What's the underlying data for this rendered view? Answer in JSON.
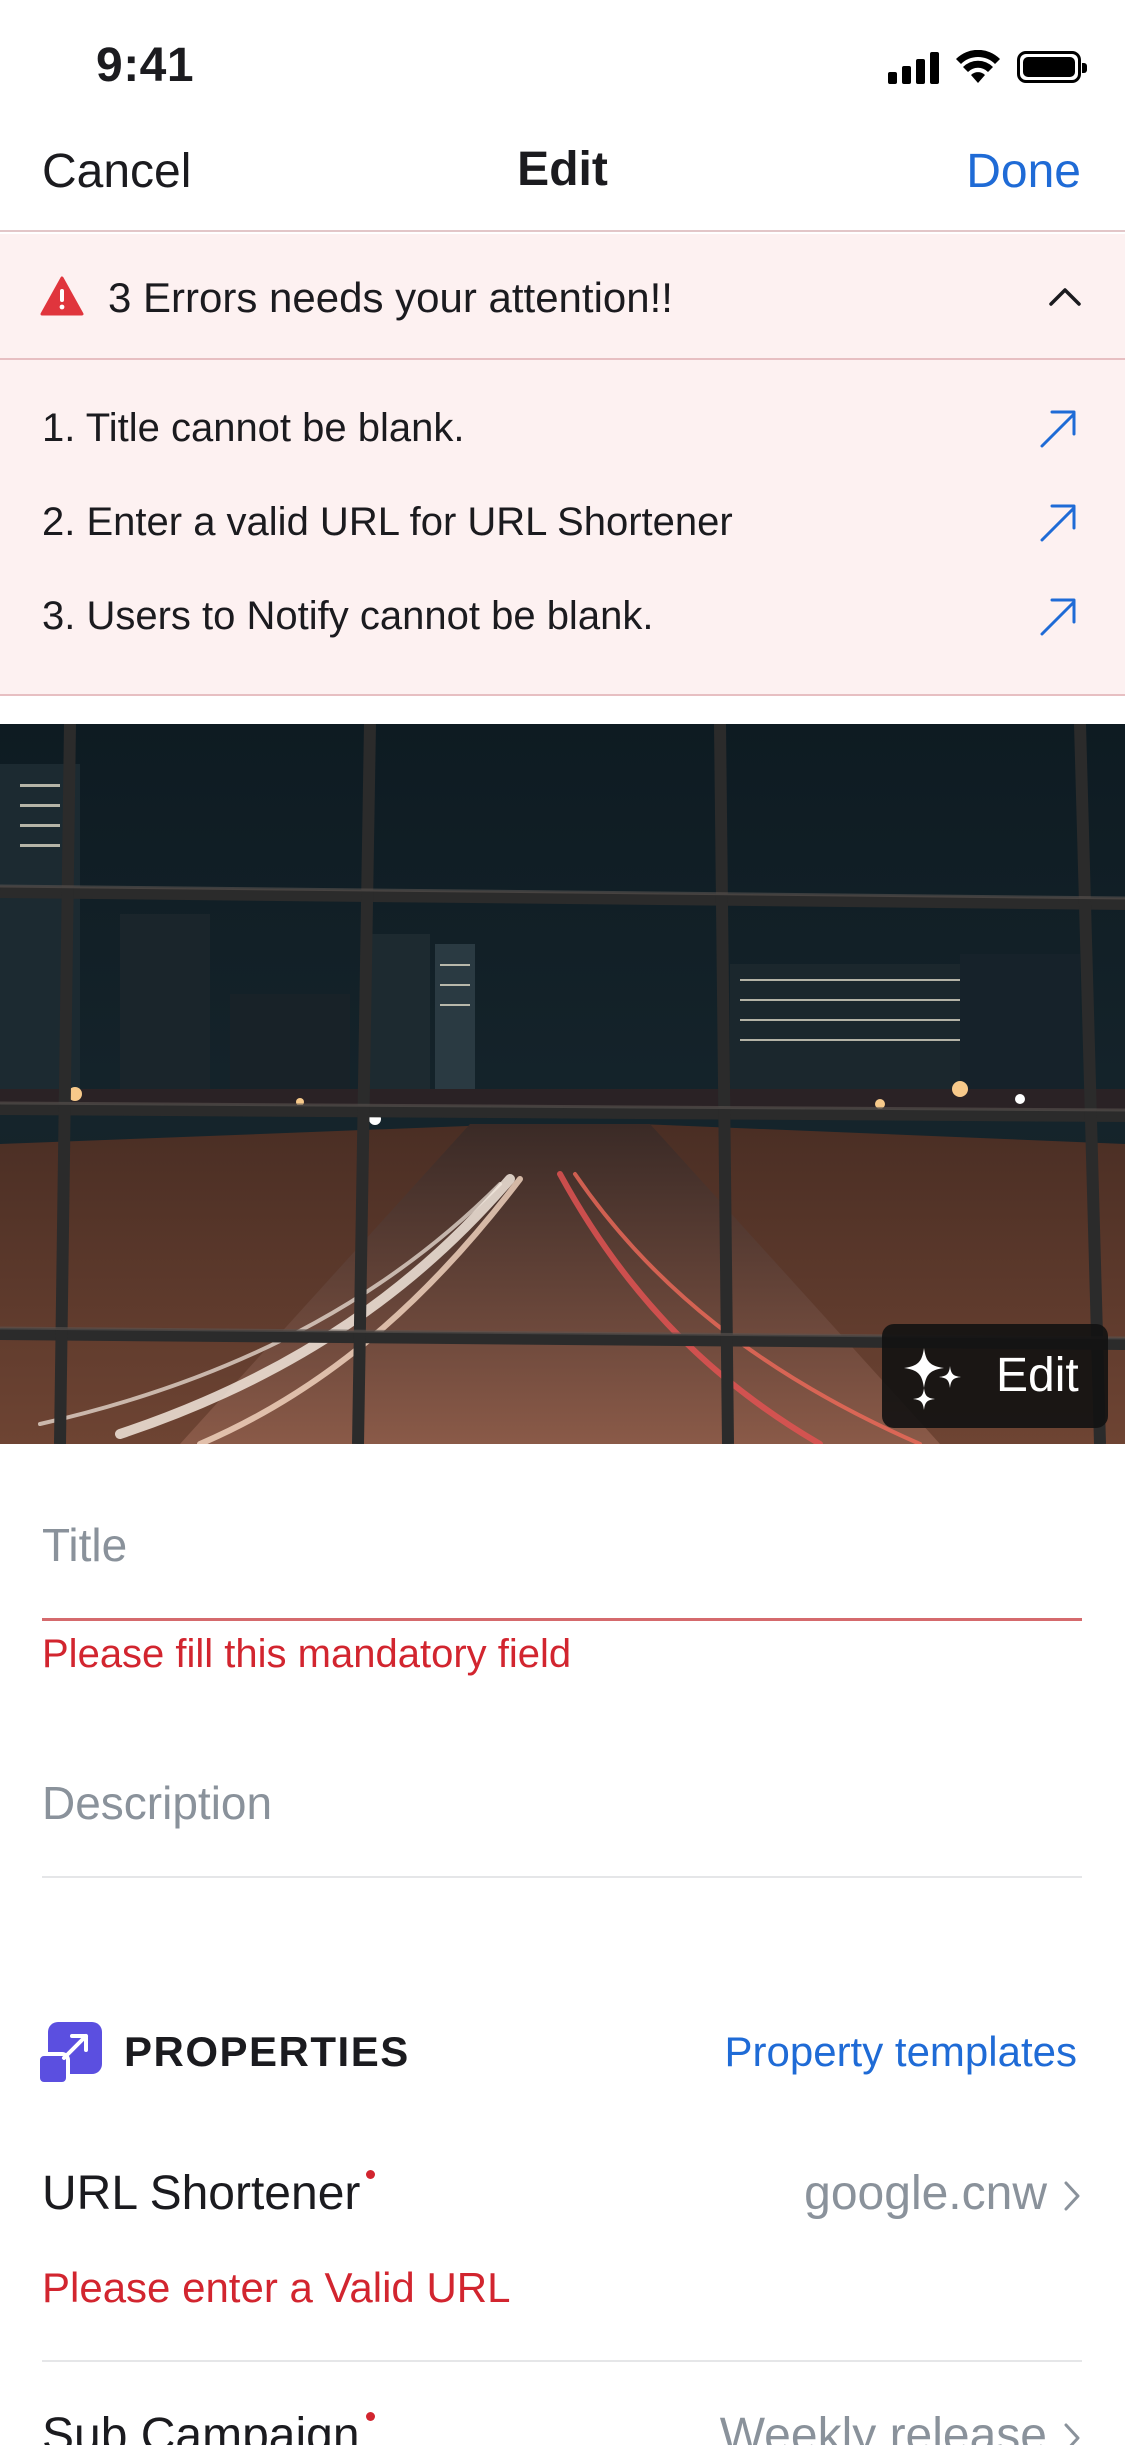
{
  "status_bar": {
    "time": "9:41"
  },
  "nav": {
    "cancel": "Cancel",
    "title": "Edit",
    "done": "Done"
  },
  "errors": {
    "header": "3 Errors needs your attention!!",
    "items": [
      "1. Title cannot be blank.",
      "2. Enter a valid URL for URL Shortener",
      "3. Users to Notify cannot be blank."
    ]
  },
  "cover": {
    "edit_label": "Edit"
  },
  "form": {
    "title_placeholder": "Title",
    "title_error": "Please fill this mandatory field",
    "description_placeholder": "Description"
  },
  "properties": {
    "title": "PROPERTIES",
    "templates_link": "Property templates",
    "rows": [
      {
        "label": "URL Shortener",
        "value": "google.cnw",
        "error": "Please enter a Valid URL"
      },
      {
        "label": "Sub Campaign",
        "value": "Weekly release"
      }
    ]
  },
  "colors": {
    "accent": "#1f6bd6",
    "error": "#d2252f",
    "error_bg": "#fdf1f1",
    "props_icon": "#5b4fe0"
  }
}
